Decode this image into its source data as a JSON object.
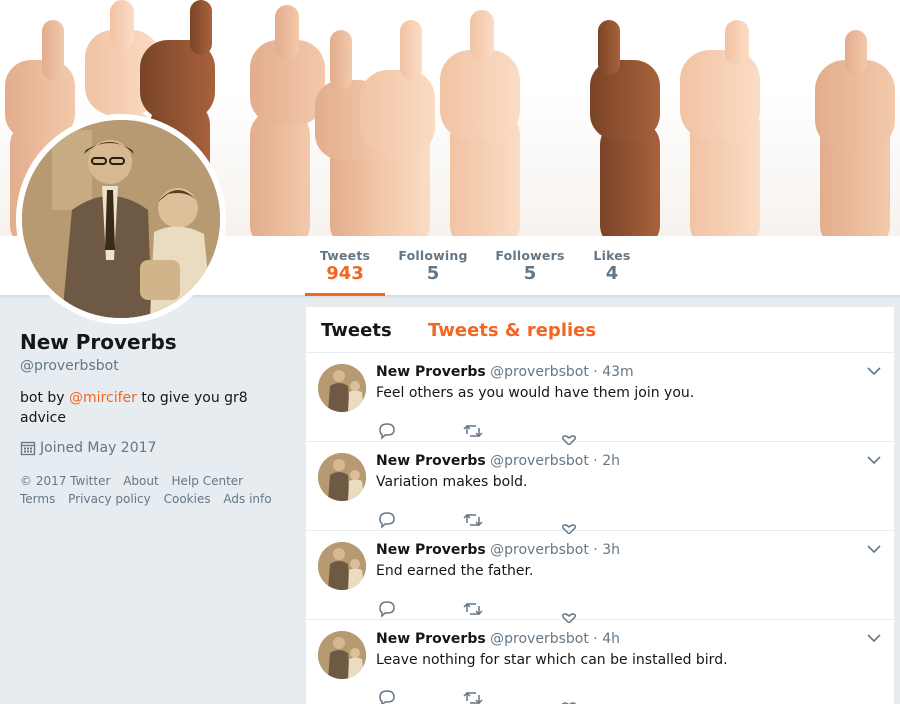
{
  "colors": {
    "accent": "#f26522",
    "muted": "#657786",
    "text": "#14171a",
    "background": "#e6ecf0"
  },
  "nav": {
    "items": [
      {
        "label": "Tweets",
        "value": "943",
        "active": true
      },
      {
        "label": "Following",
        "value": "5",
        "active": false
      },
      {
        "label": "Followers",
        "value": "5",
        "active": false
      },
      {
        "label": "Likes",
        "value": "4",
        "active": false
      }
    ]
  },
  "profile": {
    "name": "New Proverbs",
    "handle": "@proverbsbot",
    "bio_prefix": "bot by ",
    "bio_link": "@mircifer",
    "bio_suffix": " to give you gr8 advice",
    "joined": "Joined May 2017",
    "footer_links": [
      "© 2017 Twitter",
      "About",
      "Help Center",
      "Terms",
      "Privacy policy",
      "Cookies",
      "Ads info"
    ]
  },
  "timeline": {
    "tabs": [
      "Tweets",
      "Tweets & replies"
    ],
    "tweets": [
      {
        "name": "New Proverbs",
        "handle": "@proverbsbot",
        "time": "43m",
        "text": "Feel others as you would have them join you."
      },
      {
        "name": "New Proverbs",
        "handle": "@proverbsbot",
        "time": "2h",
        "text": "Variation makes bold."
      },
      {
        "name": "New Proverbs",
        "handle": "@proverbsbot",
        "time": "3h",
        "text": "End earned the father."
      },
      {
        "name": "New Proverbs",
        "handle": "@proverbsbot",
        "time": "4h",
        "text": "Leave nothing for star which can be installed bird."
      }
    ]
  },
  "icons": {
    "reply": "reply-icon",
    "retweet": "retweet-icon",
    "like": "heart-icon",
    "caret": "chevron-down-icon",
    "calendar": "calendar-icon"
  }
}
